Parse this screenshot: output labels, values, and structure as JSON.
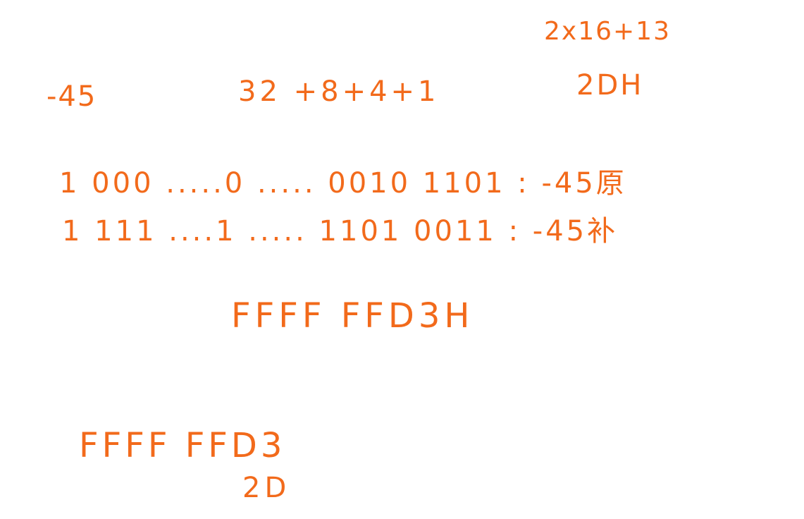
{
  "ink_color": "#f26a1b",
  "handwriting": {
    "lines": [
      {
        "id": "neg45",
        "text": "-45"
      },
      {
        "id": "sum",
        "text": "32 +8+4+1"
      },
      {
        "id": "hexcalc",
        "text": "2x16+13"
      },
      {
        "id": "hex2d",
        "text": "2DH"
      },
      {
        "id": "orig_code",
        "text": "1 000 .....0 ..... 0010 1101 : -45原"
      },
      {
        "id": "comp_code",
        "text": "1 111 ....1 ..... 1101 0011 : -45补"
      },
      {
        "id": "hex_result",
        "text": "FFFF FFD3H"
      },
      {
        "id": "hex_result2",
        "text": "FFFF FFD3"
      },
      {
        "id": "hex_2d",
        "text": "2D"
      }
    ]
  }
}
